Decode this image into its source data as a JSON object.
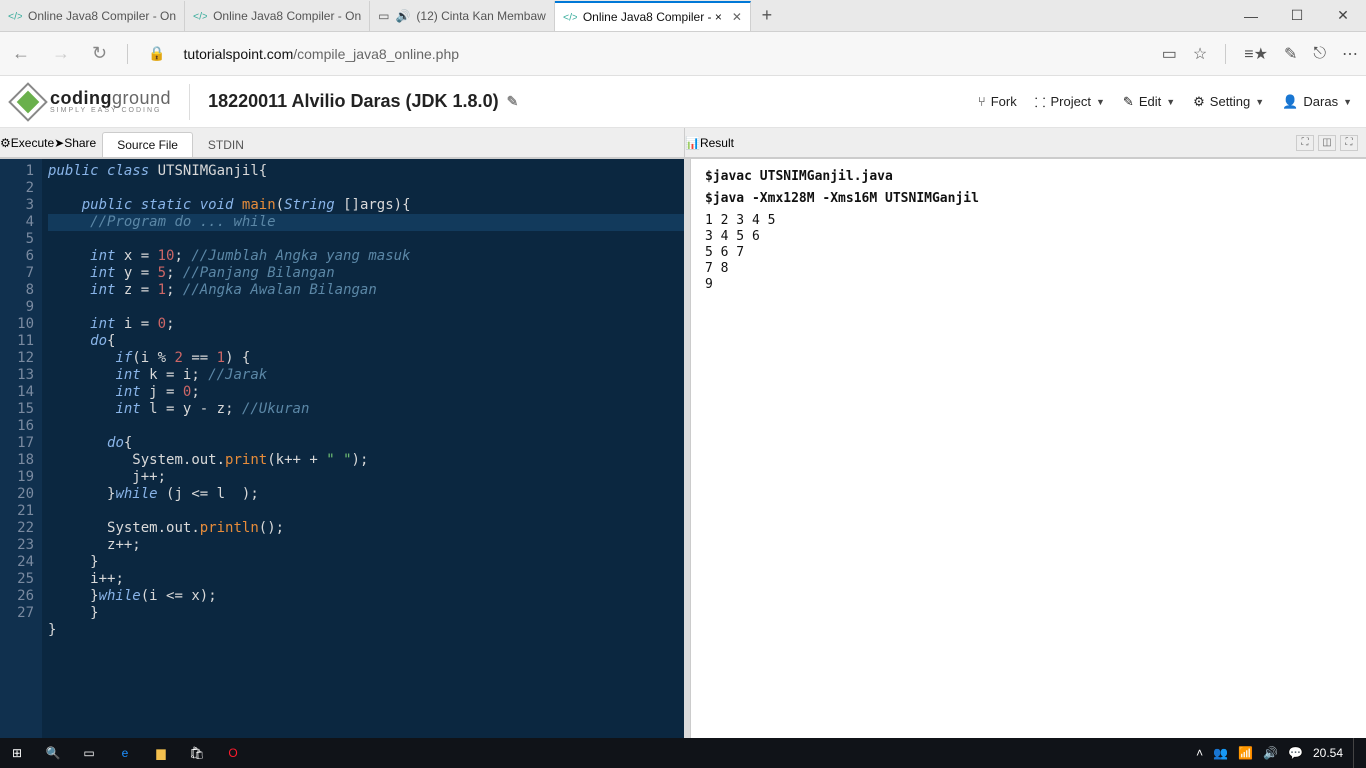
{
  "browser": {
    "tabs": [
      {
        "title": "Online Java8 Compiler - On"
      },
      {
        "title": "Online Java8 Compiler - On"
      },
      {
        "title": "(12) Cinta Kan Membaw"
      },
      {
        "title": "Online Java8 Compiler - ×",
        "active": true
      }
    ],
    "url_host": "tutorialspoint.com",
    "url_path": "/compile_java8_online.php"
  },
  "header": {
    "logo_main": "coding",
    "logo_sub": "ground",
    "logo_tag": "SIMPLY EASY CODING",
    "project_title": "18220011 Alvilio Daras (JDK 1.8.0)",
    "menu": {
      "fork": "Fork",
      "project": "Project",
      "edit": "Edit",
      "setting": "Setting",
      "user": "Daras"
    }
  },
  "toolbar": {
    "execute": "Execute",
    "share": "Share",
    "tab_source": "Source File",
    "tab_stdin": "STDIN",
    "result": "Result"
  },
  "editor": {
    "active_line": 4,
    "lines": [
      [
        [
          "kw",
          "public"
        ],
        [
          "pun",
          " "
        ],
        [
          "kw",
          "class"
        ],
        [
          "pun",
          " "
        ],
        [
          "cls",
          "UTSNIMGanjil"
        ],
        [
          "pun",
          "{"
        ]
      ],
      [],
      [
        [
          "pun",
          "    "
        ],
        [
          "kw",
          "public"
        ],
        [
          "pun",
          " "
        ],
        [
          "kw",
          "static"
        ],
        [
          "pun",
          " "
        ],
        [
          "type",
          "void"
        ],
        [
          "pun",
          " "
        ],
        [
          "fn",
          "main"
        ],
        [
          "pun",
          "("
        ],
        [
          "type",
          "String"
        ],
        [
          "pun",
          " []"
        ],
        [
          "id",
          "args"
        ],
        [
          "pun",
          "){"
        ]
      ],
      [
        [
          "pun",
          "     "
        ],
        [
          "cmt",
          "//Program do ... while"
        ]
      ],
      [
        [
          "pun",
          "     "
        ],
        [
          "type",
          "int"
        ],
        [
          "pun",
          " "
        ],
        [
          "id",
          "x"
        ],
        [
          "pun",
          " = "
        ],
        [
          "num",
          "10"
        ],
        [
          "pun",
          "; "
        ],
        [
          "cmt",
          "//Jumblah Angka yang masuk"
        ]
      ],
      [
        [
          "pun",
          "     "
        ],
        [
          "type",
          "int"
        ],
        [
          "pun",
          " "
        ],
        [
          "id",
          "y"
        ],
        [
          "pun",
          " = "
        ],
        [
          "num",
          "5"
        ],
        [
          "pun",
          "; "
        ],
        [
          "cmt",
          "//Panjang Bilangan"
        ]
      ],
      [
        [
          "pun",
          "     "
        ],
        [
          "type",
          "int"
        ],
        [
          "pun",
          " "
        ],
        [
          "id",
          "z"
        ],
        [
          "pun",
          " = "
        ],
        [
          "num",
          "1"
        ],
        [
          "pun",
          "; "
        ],
        [
          "cmt",
          "//Angka Awalan Bilangan"
        ]
      ],
      [],
      [
        [
          "pun",
          "     "
        ],
        [
          "type",
          "int"
        ],
        [
          "pun",
          " "
        ],
        [
          "id",
          "i"
        ],
        [
          "pun",
          " = "
        ],
        [
          "num",
          "0"
        ],
        [
          "pun",
          ";"
        ]
      ],
      [
        [
          "pun",
          "     "
        ],
        [
          "kw",
          "do"
        ],
        [
          "pun",
          "{"
        ]
      ],
      [
        [
          "pun",
          "        "
        ],
        [
          "kw",
          "if"
        ],
        [
          "pun",
          "("
        ],
        [
          "id",
          "i"
        ],
        [
          "pun",
          " % "
        ],
        [
          "num",
          "2"
        ],
        [
          "pun",
          " == "
        ],
        [
          "num",
          "1"
        ],
        [
          "pun",
          ") {"
        ]
      ],
      [
        [
          "pun",
          "        "
        ],
        [
          "type",
          "int"
        ],
        [
          "pun",
          " "
        ],
        [
          "id",
          "k"
        ],
        [
          "pun",
          " = "
        ],
        [
          "id",
          "i"
        ],
        [
          "pun",
          "; "
        ],
        [
          "cmt",
          "//Jarak"
        ]
      ],
      [
        [
          "pun",
          "        "
        ],
        [
          "type",
          "int"
        ],
        [
          "pun",
          " "
        ],
        [
          "id",
          "j"
        ],
        [
          "pun",
          " = "
        ],
        [
          "num",
          "0"
        ],
        [
          "pun",
          ";"
        ]
      ],
      [
        [
          "pun",
          "        "
        ],
        [
          "type",
          "int"
        ],
        [
          "pun",
          " "
        ],
        [
          "id",
          "l"
        ],
        [
          "pun",
          " = "
        ],
        [
          "id",
          "y"
        ],
        [
          "pun",
          " - "
        ],
        [
          "id",
          "z"
        ],
        [
          "pun",
          "; "
        ],
        [
          "cmt",
          "//Ukuran"
        ]
      ],
      [],
      [
        [
          "pun",
          "       "
        ],
        [
          "kw",
          "do"
        ],
        [
          "pun",
          "{"
        ]
      ],
      [
        [
          "pun",
          "          "
        ],
        [
          "id",
          "System"
        ],
        [
          "pun",
          "."
        ],
        [
          "id",
          "out"
        ],
        [
          "pun",
          "."
        ],
        [
          "fn",
          "print"
        ],
        [
          "pun",
          "("
        ],
        [
          "id",
          "k"
        ],
        [
          "pun",
          "++ + "
        ],
        [
          "str",
          "\" \""
        ],
        [
          "pun",
          ");"
        ]
      ],
      [
        [
          "pun",
          "          "
        ],
        [
          "id",
          "j"
        ],
        [
          "pun",
          "++;"
        ]
      ],
      [
        [
          "pun",
          "       }"
        ],
        [
          "kw",
          "while"
        ],
        [
          "pun",
          " ("
        ],
        [
          "id",
          "j"
        ],
        [
          "pun",
          " <= "
        ],
        [
          "id",
          "l"
        ],
        [
          "pun",
          "  );"
        ]
      ],
      [],
      [
        [
          "pun",
          "       "
        ],
        [
          "id",
          "System"
        ],
        [
          "pun",
          "."
        ],
        [
          "id",
          "out"
        ],
        [
          "pun",
          "."
        ],
        [
          "fn",
          "println"
        ],
        [
          "pun",
          "();"
        ]
      ],
      [
        [
          "pun",
          "       "
        ],
        [
          "id",
          "z"
        ],
        [
          "pun",
          "++;"
        ]
      ],
      [
        [
          "pun",
          "     }"
        ]
      ],
      [
        [
          "pun",
          "     "
        ],
        [
          "id",
          "i"
        ],
        [
          "pun",
          "++;"
        ]
      ],
      [
        [
          "pun",
          "     }"
        ],
        [
          "kw",
          "while"
        ],
        [
          "pun",
          "("
        ],
        [
          "id",
          "i"
        ],
        [
          "pun",
          " <= "
        ],
        [
          "id",
          "x"
        ],
        [
          "pun",
          ");"
        ]
      ],
      [
        [
          "pun",
          "     }"
        ]
      ],
      [
        [
          "pun",
          "}"
        ]
      ]
    ]
  },
  "output": {
    "cmd1": "$javac UTSNIMGanjil.java",
    "cmd2": "$java -Xmx128M -Xms16M UTSNIMGanjil",
    "body": "1 2 3 4 5\n3 4 5 6\n5 6 7\n7 8\n9"
  },
  "taskbar": {
    "clock": "20.54"
  }
}
